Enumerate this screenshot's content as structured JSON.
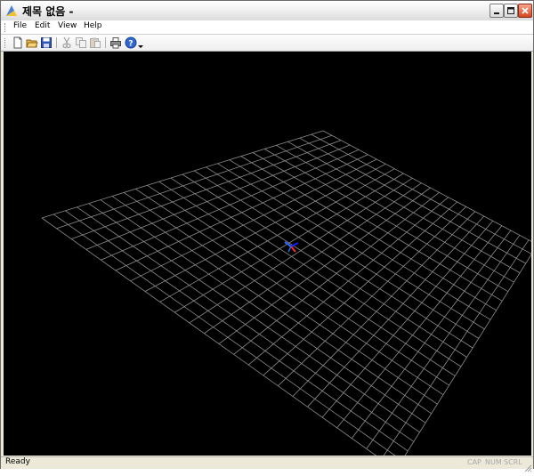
{
  "window": {
    "title": "제목 없음 - "
  },
  "menu": {
    "items": [
      "File",
      "Edit",
      "View",
      "Help"
    ]
  },
  "toolbar": {
    "buttons": [
      {
        "icon": "new-file-icon",
        "enabled": true
      },
      {
        "icon": "open-folder-icon",
        "enabled": true
      },
      {
        "icon": "save-disk-icon",
        "enabled": true
      },
      {
        "icon": "cut-scissors-icon",
        "enabled": false
      },
      {
        "icon": "copy-icon",
        "enabled": false
      },
      {
        "icon": "paste-icon",
        "enabled": false
      },
      {
        "icon": "print-icon",
        "enabled": true
      },
      {
        "icon": "help-icon",
        "enabled": true
      },
      {
        "icon": "dropdown-arrow-icon",
        "enabled": true
      }
    ]
  },
  "viewport": {
    "background": "#000000",
    "grid_color": "#8c8c8c",
    "grid_divisions": 24,
    "axis_colors": {
      "x": "#ff2a2a",
      "y": "#2a6bff",
      "z": "#1a1aff"
    }
  },
  "status": {
    "text": "Ready",
    "indicators": [
      "CAP",
      "NUM",
      "SCRL"
    ]
  }
}
